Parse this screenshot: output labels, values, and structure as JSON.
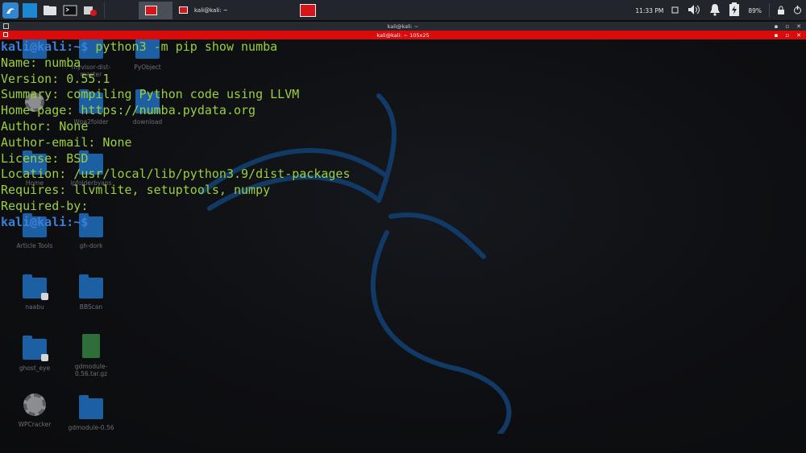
{
  "panel": {
    "tasks": [
      {
        "label": ""
      },
      {
        "label": "kali@kali: ~"
      },
      {
        "label": ""
      }
    ],
    "clock": "11:33 PM",
    "battery": "89%"
  },
  "window": {
    "title": "kali@kali: ~",
    "tab_title": "kali@kali: ~ 105x25"
  },
  "desktop": {
    "icons": [
      {
        "label": ""
      },
      {
        "label": "myvisor-dist-master"
      },
      {
        "label": "PyObject"
      },
      {
        "label": ""
      },
      {
        "label": "Wpa2folder"
      },
      {
        "label": "download"
      },
      {
        "label": "Home"
      },
      {
        "label": "ipfolderbyaps"
      },
      {
        "label": "Article Tools"
      },
      {
        "label": "gh-dork"
      },
      {
        "label": "naabu"
      },
      {
        "label": "BBScan"
      },
      {
        "label": "ghost_eye"
      },
      {
        "label": "gdmodule-0.56.tar.gz"
      },
      {
        "label": "WPCracker"
      },
      {
        "label": "gdmodule-0.56"
      }
    ]
  },
  "terminal": {
    "prompt_user": "kali@kali",
    "prompt_path": ":~$",
    "command": " python3 -m pip show numba",
    "output": [
      "Name: numba",
      "Version: 0.55.1",
      "Summary: compiling Python code using LLVM",
      "Home-page: https://numba.pydata.org",
      "Author: None",
      "Author-email: None",
      "License: BSD",
      "Location: /usr/local/lib/python3.9/dist-packages",
      "Requires: llvmlite, setuptools, numpy",
      "Required-by:"
    ],
    "final_prompt_user": "kali@kali",
    "final_prompt_path": ":~$"
  }
}
